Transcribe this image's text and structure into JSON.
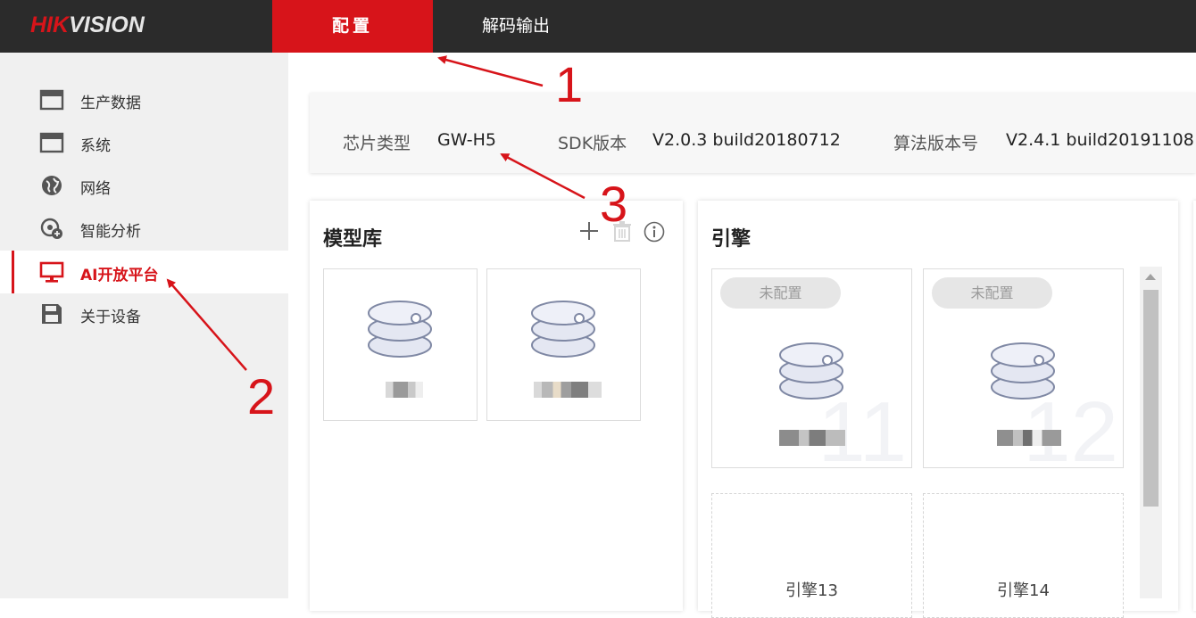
{
  "app": {
    "logo_part1": "HIK",
    "logo_part2": "VISION"
  },
  "nav": {
    "tabs": [
      {
        "label": "配置",
        "active": true
      },
      {
        "label": "解码输出",
        "active": false
      }
    ]
  },
  "sidebar": {
    "items": [
      {
        "label": "生产数据",
        "icon": "window-icon"
      },
      {
        "label": "系统",
        "icon": "window-icon"
      },
      {
        "label": "网络",
        "icon": "globe-icon"
      },
      {
        "label": "智能分析",
        "icon": "smart-analysis-icon"
      },
      {
        "label": "AI开放平台",
        "icon": "monitor-icon",
        "active": true
      },
      {
        "label": "关于设备",
        "icon": "save-icon"
      }
    ]
  },
  "info": {
    "chip_label": "芯片类型",
    "chip_value": "GW-H5",
    "sdk_label": "SDK版本",
    "sdk_value": "V2.0.3 build20180712",
    "algo_label": "算法版本号",
    "algo_value": "V2.4.1 build20191108"
  },
  "model_lib": {
    "title": "模型库",
    "actions": [
      "add-icon",
      "trash-icon",
      "info-icon"
    ]
  },
  "engine": {
    "title": "引擎",
    "cards": [
      {
        "status": "未配置",
        "number": "11"
      },
      {
        "status": "未配置",
        "number": "12"
      },
      {
        "label": "引擎13"
      },
      {
        "label": "引擎14"
      }
    ]
  },
  "annotations": [
    "1",
    "2",
    "3"
  ],
  "colors": {
    "accent": "#d7141a",
    "topbar": "#2b2b2b",
    "sidebar": "#f0f0f0"
  }
}
